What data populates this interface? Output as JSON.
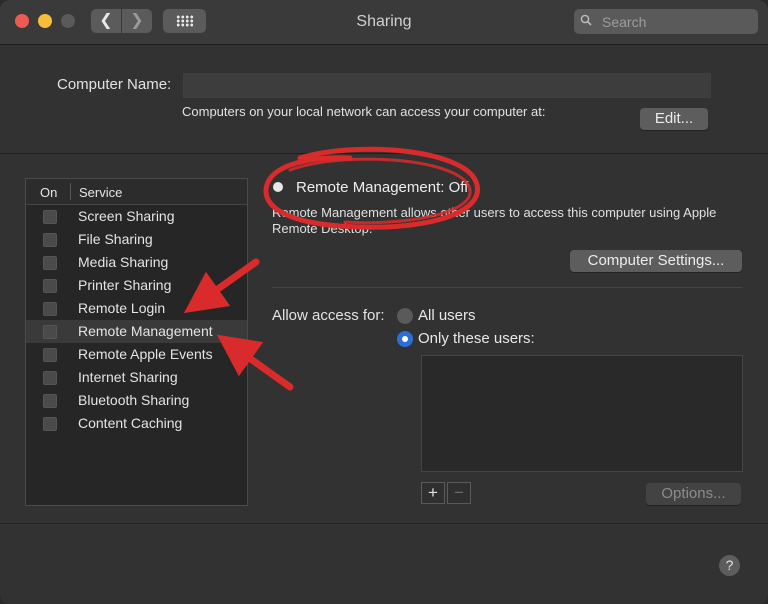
{
  "window": {
    "title": "Sharing"
  },
  "search": {
    "placeholder": "Search"
  },
  "computer_name": {
    "label": "Computer Name:",
    "value": ""
  },
  "access_text": "Computers on your local network can access your computer at:",
  "edit_label": "Edit...",
  "services": {
    "header_on": "On",
    "header_service": "Service",
    "items": [
      {
        "label": "Screen Sharing",
        "checked": false
      },
      {
        "label": "File Sharing",
        "checked": false
      },
      {
        "label": "Media Sharing",
        "checked": false
      },
      {
        "label": "Printer Sharing",
        "checked": false
      },
      {
        "label": "Remote Login",
        "checked": false
      },
      {
        "label": "Remote Management",
        "checked": false,
        "selected": true
      },
      {
        "label": "Remote Apple Events",
        "checked": false
      },
      {
        "label": "Internet Sharing",
        "checked": false
      },
      {
        "label": "Bluetooth Sharing",
        "checked": false
      },
      {
        "label": "Content Caching",
        "checked": false
      }
    ]
  },
  "detail": {
    "status": "Remote Management: Off",
    "description": "Remote Management allows other users to access this computer using Apple Remote Desktop.",
    "computer_settings_label": "Computer Settings...",
    "allow_access_label": "Allow access for:",
    "all_users_label": "All users",
    "only_these_users_label": "Only these users:",
    "selected_access": "only_these_users",
    "plus_label": "+",
    "minus_label": "−",
    "options_label": "Options..."
  },
  "help_label": "?",
  "colors": {
    "accent": "#2d6fd9",
    "annotation": "#d92b2b",
    "close": "#ee5a52",
    "minimize": "#f4be3b"
  }
}
